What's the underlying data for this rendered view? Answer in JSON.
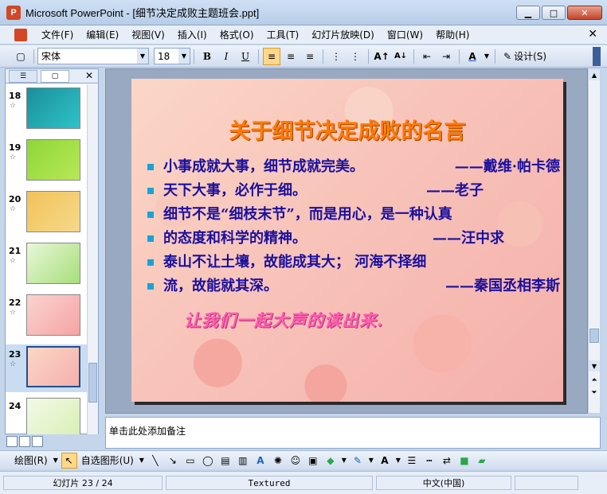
{
  "window": {
    "title": "Microsoft PowerPoint - [细节决定成败主题班会.ppt]",
    "app_icon_letter": "P",
    "minimize": "▁",
    "maximize": "□",
    "close": "✕"
  },
  "menu": {
    "items": [
      "文件(F)",
      "编辑(E)",
      "视图(V)",
      "插入(I)",
      "格式(O)",
      "工具(T)",
      "幻灯片放映(D)",
      "窗口(W)",
      "帮助(H)"
    ],
    "close": "✕"
  },
  "toolbar": {
    "font_name": "宋体",
    "font_size": "18",
    "bold": "B",
    "italic": "I",
    "underline": "U",
    "design_label": "设计(S)"
  },
  "thumbnails": {
    "items": [
      {
        "number": "18",
        "star": "☆"
      },
      {
        "number": "19",
        "star": "☆"
      },
      {
        "number": "20",
        "star": "☆"
      },
      {
        "number": "21",
        "star": "☆"
      },
      {
        "number": "22",
        "star": "☆"
      },
      {
        "number": "23",
        "star": "☆"
      },
      {
        "number": "24",
        "star": ""
      }
    ],
    "selected": "23"
  },
  "slide": {
    "title": "关于细节决定成败的名言",
    "bullets": [
      {
        "text": "小事成就大事，细节成就完美。",
        "author": "——戴维·帕卡德"
      },
      {
        "text": "天下大事，必作于细。",
        "author": "——老子"
      },
      {
        "text": "细节不是“细枝末节”，而是用心，是一种认真",
        "author": ""
      },
      {
        "text": "的态度和科学的精神。",
        "author": "——汪中求"
      },
      {
        "text": "泰山不让土壤，故能成其大；  河海不择细",
        "author": ""
      },
      {
        "text": "流，故能就其深。",
        "author": "——秦国丞相李斯"
      }
    ],
    "footer_art": "让我们一起大声的读出来."
  },
  "notes": {
    "placeholder": "单击此处添加备注"
  },
  "drawing": {
    "draw_label": "绘图(R)",
    "autoshape_label": "自选图形(U)"
  },
  "status": {
    "slide_pos": "幻灯片 23 / 24",
    "template": "Textured",
    "language": "中文(中国)"
  }
}
